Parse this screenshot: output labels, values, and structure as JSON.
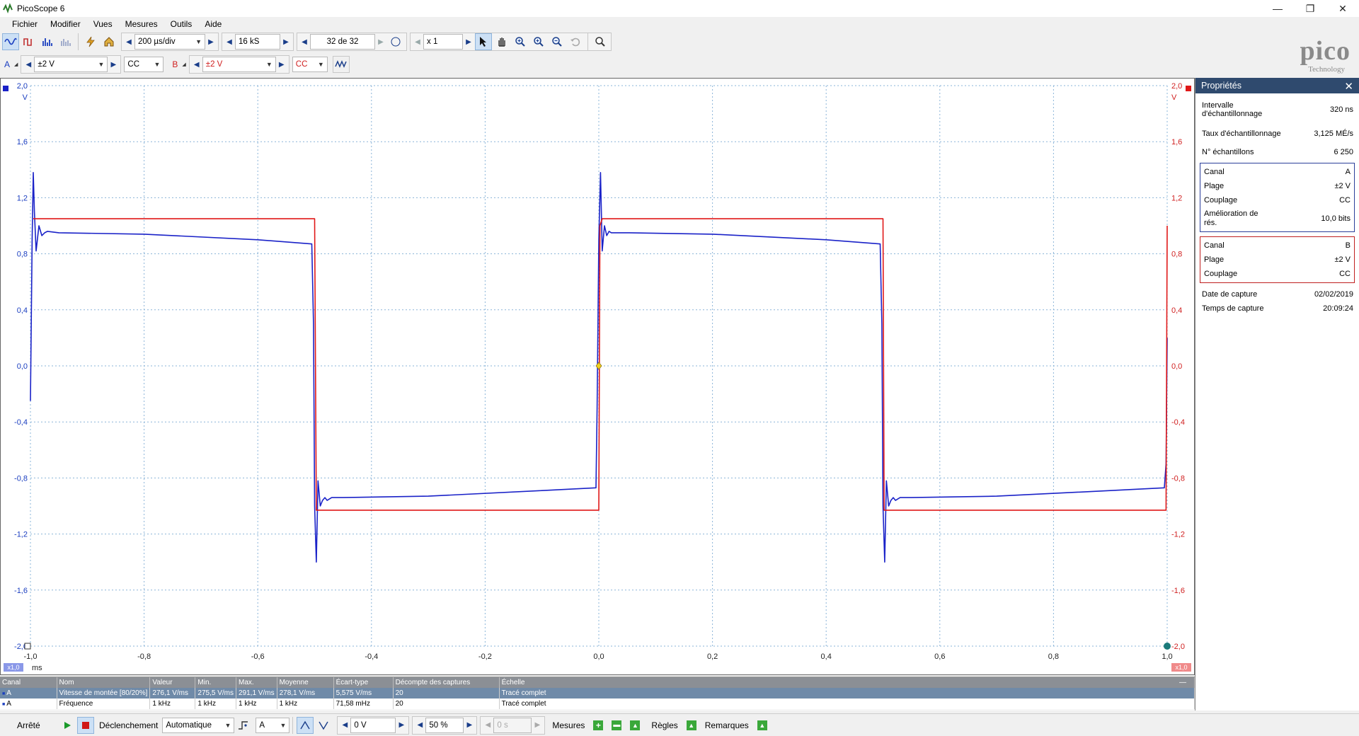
{
  "window": {
    "title": "PicoScope 6",
    "minimize": "—",
    "restore": "❐",
    "close": "✕"
  },
  "menu": [
    "Fichier",
    "Modifier",
    "Vues",
    "Mesures",
    "Outils",
    "Aide"
  ],
  "toolbar1": {
    "timebase": "200 µs/div",
    "samples": "16 kS",
    "capture": "32 de 32",
    "zoom": "x 1"
  },
  "toolbar2": {
    "channel_a": {
      "label": "A",
      "range": "±2 V",
      "coupling": "CC",
      "color": "#1a3ec0"
    },
    "channel_b": {
      "label": "B",
      "range": "±2 V",
      "coupling": "CC",
      "color": "#d02020"
    }
  },
  "logo": {
    "word": "pico",
    "sub": "Technology"
  },
  "chart_data": {
    "type": "line",
    "xlabel": "ms",
    "xlim": [
      -1.0,
      1.0
    ],
    "ylim": [
      -2.0,
      2.0
    ],
    "x_ticks": [
      "-1,0",
      "-0,8",
      "-0,6",
      "-0,4",
      "-0,2",
      "0,0",
      "0,2",
      "0,4",
      "0,6",
      "0,8",
      "1,0"
    ],
    "y_ticks_left": [
      "2,0",
      "1,6",
      "1,2",
      "0,8",
      "0,4",
      "0,0",
      "-0,4",
      "-0,8",
      "-1,2",
      "-1,6",
      "-2,0"
    ],
    "y_ticks_right": [
      "2,0",
      "1,6",
      "1,2",
      "0,8",
      "0,4",
      "0,0",
      "-0,4",
      "-0,8",
      "-1,2",
      "-1,6",
      "-2,0"
    ],
    "y_unit": "V",
    "grid": true,
    "x_scale_badge_left": "x1,0",
    "x_scale_badge_right": "x1,0",
    "series": [
      {
        "name": "A",
        "color": "#1a22c8",
        "x": [
          -1.0,
          -0.997,
          -0.995,
          -0.993,
          -0.99,
          -0.985,
          -0.98,
          -0.975,
          -0.97,
          -0.95,
          -0.8,
          -0.6,
          -0.505,
          -0.502,
          -0.5,
          -0.497,
          -0.494,
          -0.49,
          -0.486,
          -0.482,
          -0.478,
          -0.47,
          -0.45,
          -0.3,
          -0.1,
          -0.005,
          -0.003,
          0.0,
          0.003,
          0.006,
          0.01,
          0.014,
          0.018,
          0.022,
          0.03,
          0.05,
          0.2,
          0.4,
          0.495,
          0.498,
          0.5,
          0.503,
          0.506,
          0.51,
          0.514,
          0.518,
          0.522,
          0.53,
          0.55,
          0.7,
          0.9,
          0.995,
          0.998,
          1.0
        ],
        "y": [
          -0.25,
          0.9,
          1.38,
          1.1,
          0.82,
          1.0,
          0.93,
          0.95,
          0.96,
          0.95,
          0.94,
          0.9,
          0.87,
          0.3,
          -1.0,
          -1.4,
          -0.82,
          -1.0,
          -0.96,
          -0.94,
          -0.96,
          -0.94,
          -0.94,
          -0.93,
          -0.89,
          -0.87,
          -0.3,
          0.9,
          1.38,
          0.82,
          1.0,
          0.93,
          0.96,
          0.95,
          0.95,
          0.95,
          0.94,
          0.9,
          0.87,
          0.3,
          -1.0,
          -1.4,
          -0.82,
          -1.0,
          -0.96,
          -0.94,
          -0.96,
          -0.94,
          -0.94,
          -0.93,
          -0.89,
          -0.87,
          -0.7,
          0.2
        ]
      },
      {
        "name": "B",
        "color": "#e01818",
        "x": [
          -0.995,
          -0.99,
          -0.5,
          -0.497,
          -0.49,
          0.0,
          0.002,
          0.006,
          0.5,
          0.502,
          0.51,
          0.998,
          1.0
        ],
        "y": [
          1.05,
          1.05,
          1.05,
          -1.03,
          -1.03,
          -1.03,
          1.0,
          1.05,
          1.05,
          -1.03,
          -1.03,
          -1.03,
          1.0
        ]
      }
    ],
    "trigger_marker": {
      "x": 0.0,
      "y": 0.0
    }
  },
  "properties": {
    "title": "Propriétés",
    "close": "✕",
    "general": [
      {
        "k": "Intervalle d'échantillonnage",
        "v": "320 ns"
      },
      {
        "k": "Taux d'échantillonnage",
        "v": "3,125 MÉ/s"
      },
      {
        "k": "N° échantillons",
        "v": "6 250"
      }
    ],
    "channel_a": [
      {
        "k": "Canal",
        "v": "A"
      },
      {
        "k": "Plage",
        "v": "±2 V"
      },
      {
        "k": "Couplage",
        "v": "CC"
      },
      {
        "k": "Amélioration de rés.",
        "v": "10,0 bits"
      }
    ],
    "channel_b": [
      {
        "k": "Canal",
        "v": "B"
      },
      {
        "k": "Plage",
        "v": "±2 V"
      },
      {
        "k": "Couplage",
        "v": "CC"
      }
    ],
    "capture": [
      {
        "k": "Date de capture",
        "v": "02/02/2019"
      },
      {
        "k": "Temps de capture",
        "v": "20:09:24"
      }
    ]
  },
  "measurements": {
    "headers": [
      "Canal",
      "Nom",
      "Valeur",
      "Min.",
      "Max.",
      "Moyenne",
      "Écart-type",
      "Décompte des captures",
      "Échelle"
    ],
    "rows": [
      [
        "A",
        "Vitesse de montée [80/20%]",
        "276,1 V/ms",
        "275,5 V/ms",
        "291,1 V/ms",
        "278,1 V/ms",
        "5,575 V/ms",
        "20",
        "Tracé complet"
      ],
      [
        "A",
        "Fréquence",
        "1 kHz",
        "1 kHz",
        "1 kHz",
        "1 kHz",
        "71,58 mHz",
        "20",
        "Tracé complet"
      ]
    ],
    "collapse": "—"
  },
  "statusbar": {
    "state": "Arrêté",
    "trigger_label": "Déclenchement",
    "trigger_mode": "Automatique",
    "trigger_source": "A",
    "trigger_level": "0 V",
    "pretrigger": "50 %",
    "delay": "0 s",
    "measures_label": "Mesures",
    "rules_label": "Règles",
    "notes_label": "Remarques"
  }
}
